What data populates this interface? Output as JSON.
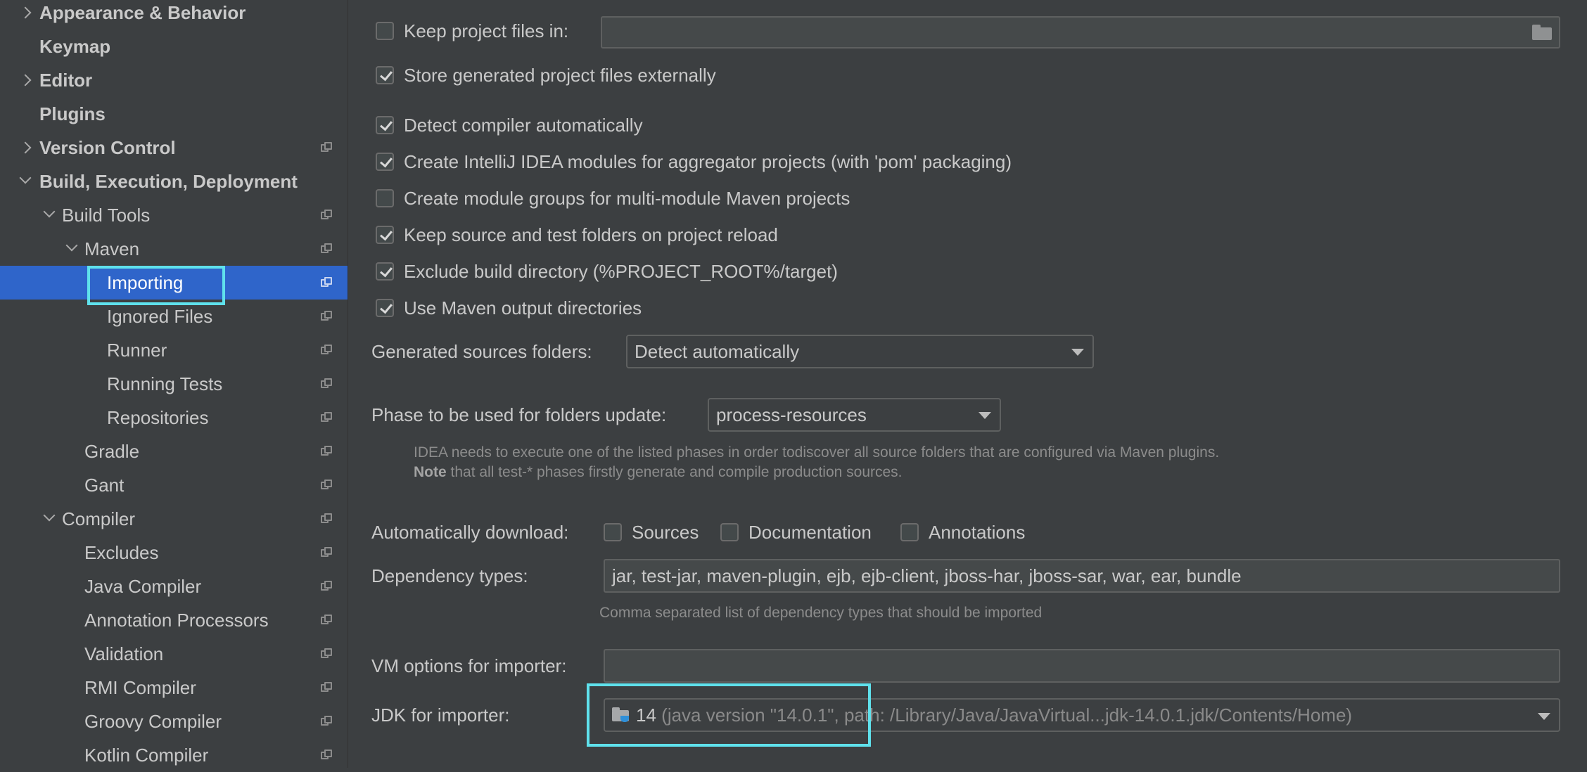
{
  "sidebar": {
    "items": [
      {
        "label": "Appearance & Behavior",
        "chevron": "right",
        "bold": true,
        "project_icon": false,
        "selected": false
      },
      {
        "label": "Keymap",
        "chevron": "none",
        "bold": true,
        "project_icon": false,
        "selected": false
      },
      {
        "label": "Editor",
        "chevron": "right",
        "bold": true,
        "project_icon": false,
        "selected": false
      },
      {
        "label": "Plugins",
        "chevron": "none",
        "bold": true,
        "project_icon": false,
        "selected": false
      },
      {
        "label": "Version Control",
        "chevron": "right",
        "bold": true,
        "project_icon": true,
        "selected": false
      },
      {
        "label": "Build, Execution, Deployment",
        "chevron": "down",
        "bold": true,
        "project_icon": false,
        "selected": false
      },
      {
        "label": "Build Tools",
        "chevron": "down",
        "bold": false,
        "project_icon": true,
        "selected": false
      },
      {
        "label": "Maven",
        "chevron": "down",
        "bold": false,
        "project_icon": true,
        "selected": false
      },
      {
        "label": "Importing",
        "chevron": "none",
        "bold": false,
        "project_icon": true,
        "selected": true
      },
      {
        "label": "Ignored Files",
        "chevron": "none",
        "bold": false,
        "project_icon": true,
        "selected": false
      },
      {
        "label": "Runner",
        "chevron": "none",
        "bold": false,
        "project_icon": true,
        "selected": false
      },
      {
        "label": "Running Tests",
        "chevron": "none",
        "bold": false,
        "project_icon": true,
        "selected": false
      },
      {
        "label": "Repositories",
        "chevron": "none",
        "bold": false,
        "project_icon": true,
        "selected": false
      },
      {
        "label": "Gradle",
        "chevron": "none",
        "bold": false,
        "project_icon": true,
        "selected": false
      },
      {
        "label": "Gant",
        "chevron": "none",
        "bold": false,
        "project_icon": true,
        "selected": false
      },
      {
        "label": "Compiler",
        "chevron": "down",
        "bold": false,
        "project_icon": true,
        "selected": false
      },
      {
        "label": "Excludes",
        "chevron": "none",
        "bold": false,
        "project_icon": true,
        "selected": false
      },
      {
        "label": "Java Compiler",
        "chevron": "none",
        "bold": false,
        "project_icon": true,
        "selected": false
      },
      {
        "label": "Annotation Processors",
        "chevron": "none",
        "bold": false,
        "project_icon": true,
        "selected": false
      },
      {
        "label": "Validation",
        "chevron": "none",
        "bold": false,
        "project_icon": true,
        "selected": false
      },
      {
        "label": "RMI Compiler",
        "chevron": "none",
        "bold": false,
        "project_icon": true,
        "selected": false
      },
      {
        "label": "Groovy Compiler",
        "chevron": "none",
        "bold": false,
        "project_icon": true,
        "selected": false
      },
      {
        "label": "Kotlin Compiler",
        "chevron": "none",
        "bold": false,
        "project_icon": true,
        "selected": false
      }
    ]
  },
  "main": {
    "checkboxes": [
      {
        "label": "Keep project files in:",
        "checked": false
      },
      {
        "label": "Store generated project files externally",
        "checked": true
      },
      {
        "label": "Detect compiler automatically",
        "checked": true
      },
      {
        "label": "Create IntelliJ IDEA modules for aggregator projects (with 'pom' packaging)",
        "checked": true
      },
      {
        "label": "Create module groups for multi-module Maven projects",
        "checked": false
      },
      {
        "label": "Keep source and test folders on project reload",
        "checked": true
      },
      {
        "label": "Exclude build directory (%PROJECT_ROOT%/target)",
        "checked": true
      },
      {
        "label": "Use Maven output directories",
        "checked": true
      }
    ],
    "keep_project_files_path": "",
    "generated_sources": {
      "label": "Generated sources folders:",
      "value": "Detect automatically"
    },
    "phase": {
      "label": "Phase to be used for folders update:",
      "value": "process-resources"
    },
    "phase_hint_1": "IDEA needs to execute one of the listed phases in order todiscover all source folders that are configured via Maven plugins.",
    "phase_hint_2_bold": "Note",
    "phase_hint_2_rest": " that all test-* phases firstly generate and compile production sources.",
    "auto_download": {
      "label": "Automatically download:",
      "options": [
        {
          "label": "Sources",
          "checked": false
        },
        {
          "label": "Documentation",
          "checked": false
        },
        {
          "label": "Annotations",
          "checked": false
        }
      ]
    },
    "dependency_types": {
      "label": "Dependency types:",
      "value": "jar, test-jar, maven-plugin, ejb, ejb-client, jboss-har, jboss-sar, war, ear, bundle",
      "hint": "Comma separated list of dependency types that should be imported"
    },
    "vm_options": {
      "label": "VM options for importer:",
      "value": ""
    },
    "jdk": {
      "label": "JDK for importer:",
      "version": "14",
      "detail": "(java version \"14.0.1\", path: /Library/Java/JavaVirtual...jdk-14.0.1.jdk/Contents/Home)"
    }
  }
}
